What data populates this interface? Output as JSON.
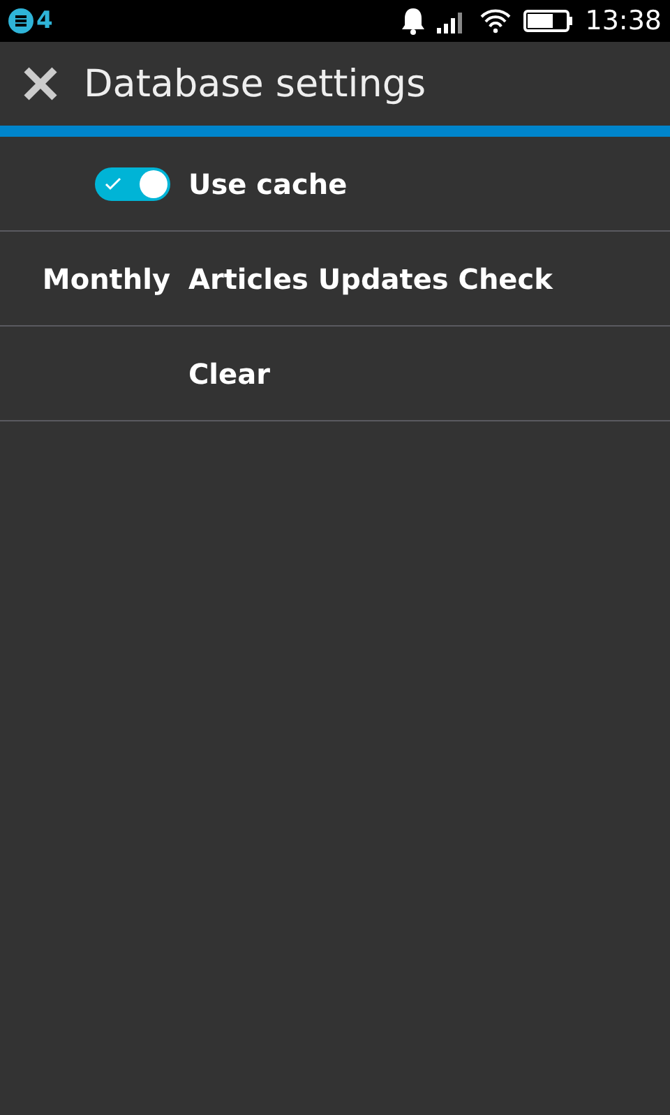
{
  "status_bar": {
    "notification_count": "4",
    "time": "13:38"
  },
  "header": {
    "title": "Database settings"
  },
  "rows": [
    {
      "kind": "toggle",
      "label": "Use cache",
      "on": true
    },
    {
      "kind": "value",
      "value": "Monthly",
      "label": "Articles Updates Check"
    },
    {
      "kind": "action",
      "label": "Clear"
    }
  ]
}
